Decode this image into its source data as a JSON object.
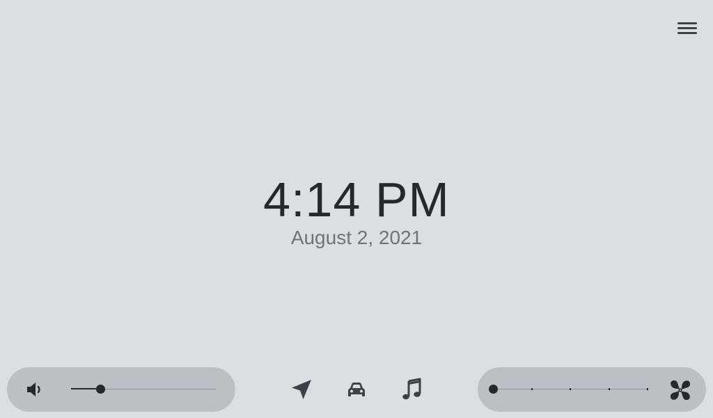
{
  "menu": {
    "icon": "hamburger-menu-icon"
  },
  "clock": {
    "time": "4:14 PM",
    "date": "August 2, 2021"
  },
  "volume": {
    "icon": "speaker-volume-icon",
    "level": 0.2
  },
  "nav": [
    {
      "id": "navigation",
      "icon": "navigation-arrow-icon"
    },
    {
      "id": "car",
      "icon": "car-icon"
    },
    {
      "id": "music",
      "icon": "music-note-icon"
    }
  ],
  "fan": {
    "icon": "fan-icon",
    "level": 0,
    "steps": 4
  },
  "colors": {
    "background": "#dcdfe2",
    "pill": "#bcbfc6",
    "foreground": "#25292f",
    "secondary_text": "#6d737b"
  }
}
